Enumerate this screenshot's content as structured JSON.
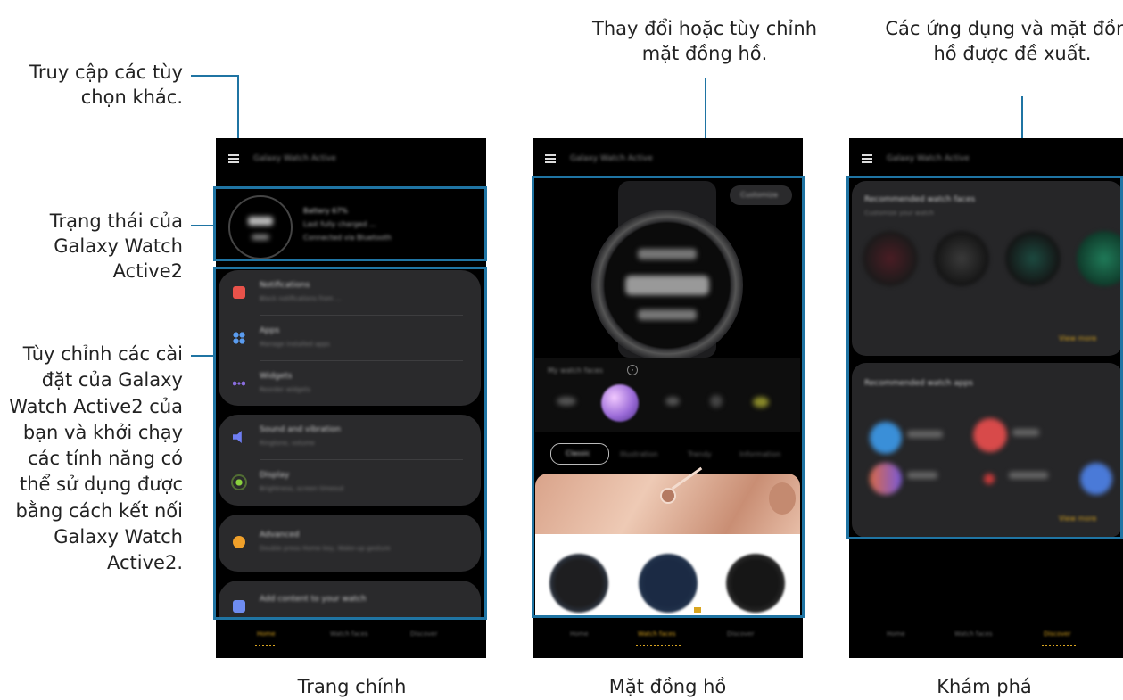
{
  "annotations": {
    "more_options": "Truy cập các tùy chọn khác.",
    "watch_status": "Trạng thái của Galaxy Watch Active2",
    "customize_settings": "Tùy chỉnh các cài đặt của Galaxy Watch Active2 của bạn và khởi chạy các tính năng có thể sử dụng được bằng cách kết nối Galaxy Watch Active2.",
    "change_watch_face": "Thay đổi hoặc tùy chỉnh mặt đồng hồ.",
    "recommended": "Các ứng dụng và mặt đồng hồ được đề xuất."
  },
  "captions": {
    "home": "Trang chính",
    "watch_faces": "Mặt đồng hồ",
    "discover": "Khám phá"
  },
  "screen_home": {
    "title": "Galaxy Watch Active",
    "status_lines": [
      "Battery 67%",
      "Last fully charged ...",
      "Connected via Bluetooth"
    ],
    "menu": [
      {
        "label": "Notifications",
        "sub": "Block notifications from ...",
        "color": "#e8524a"
      },
      {
        "label": "Apps",
        "sub": "Manage installed apps",
        "color": "#5a9cf0"
      },
      {
        "label": "Widgets",
        "sub": "Reorder widgets",
        "color": "#8a6de0"
      },
      {
        "label": "Sound and vibration",
        "sub": "Ringtone, volume",
        "color": "#6e7df2"
      },
      {
        "label": "Display",
        "sub": "Brightness, screen timeout",
        "color": "#8bd13e"
      },
      {
        "label": "Advanced",
        "sub": "Double press Home key, Wake-up gesture",
        "color": "#f0a02a"
      },
      {
        "label": "Add content to your watch",
        "sub": "",
        "color": "#6e8cf0"
      }
    ],
    "nav": [
      "Home",
      "Watch faces",
      "Discover"
    ]
  },
  "screen_faces": {
    "title": "Galaxy Watch Active",
    "customize_btn": "Customize",
    "my_faces": "My watch faces",
    "tabs": [
      "Classic",
      "Illustration",
      "Trendy",
      "Information"
    ],
    "nav": [
      "Home",
      "Watch faces",
      "Discover"
    ]
  },
  "screen_discover": {
    "title": "Galaxy Watch Active",
    "sec1_title": "Recommended watch faces",
    "sec1_sub": "Customize your watch",
    "sec2_title": "Recommended watch apps",
    "view_more": "View more",
    "nav": [
      "Home",
      "Watch faces",
      "Discover"
    ]
  }
}
